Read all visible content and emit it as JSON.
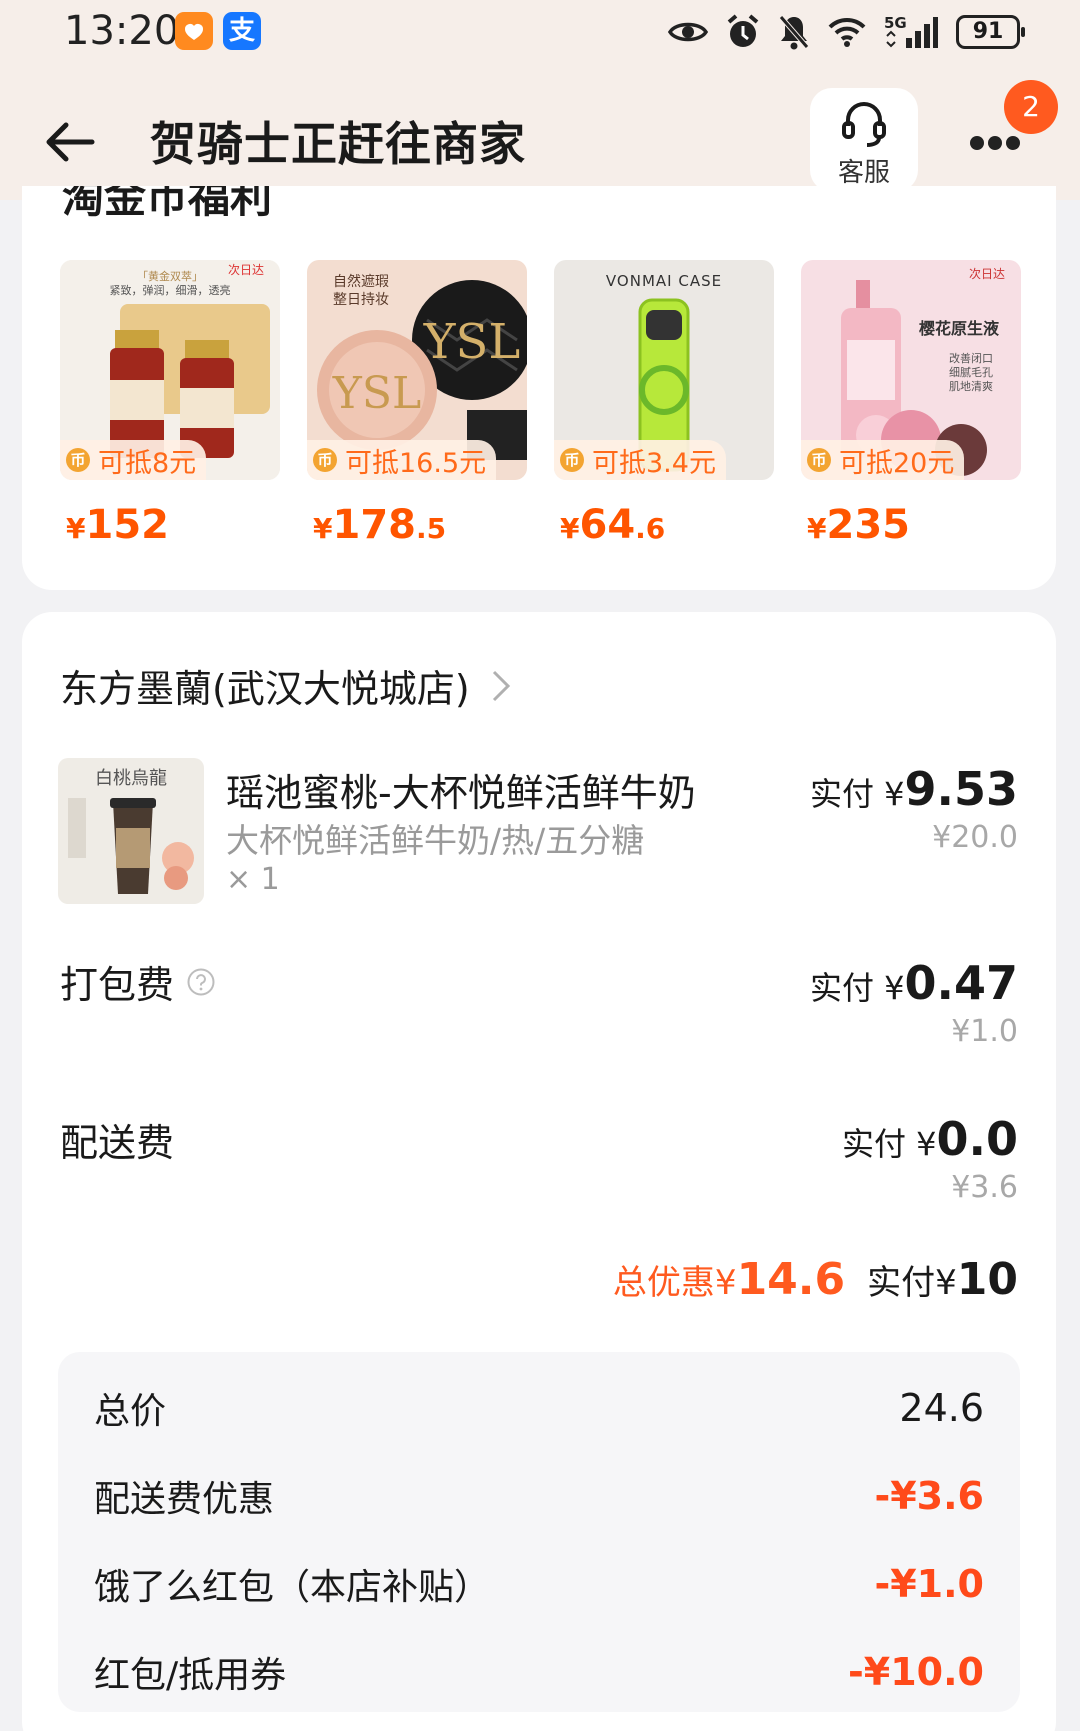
{
  "status_bar": {
    "time": "13:20",
    "apps": [
      "taobao-icon",
      "alipay-icon"
    ],
    "alipay_glyph": "支",
    "network": "5G",
    "battery": "91"
  },
  "header": {
    "title": "贺骑士正赶往商家",
    "customer_service_label": "客服",
    "notification_count": "2"
  },
  "coin_benefits": {
    "title": "淘金币福利",
    "products": [
      {
        "image": "clarins-serum-image",
        "image_texts": [
          "次日达",
          "「黄金双萃」",
          "紧致，弹润，细滑，透亮"
        ],
        "coupon": "可抵8元",
        "price_yen": "¥",
        "price_int": "152",
        "price_dec": ""
      },
      {
        "image": "ysl-cushion-image",
        "image_texts": [
          "自然遮瑕",
          "整日持妆"
        ],
        "coupon": "可抵16.5元",
        "price_yen": "¥",
        "price_int": "178",
        "price_dec": ".5"
      },
      {
        "image": "phone-case-image",
        "image_texts": [
          "VONMAI CASE"
        ],
        "coupon": "可抵3.4元",
        "price_yen": "¥",
        "price_int": "64",
        "price_dec": ".6"
      },
      {
        "image": "estee-lauder-essence-image",
        "image_texts": [
          "次日达",
          "樱花原生液",
          "改善闭口",
          "细腻毛孔",
          "肌地清爽"
        ],
        "coupon": "可抵20元",
        "price_yen": "¥",
        "price_int": "235",
        "price_dec": ""
      }
    ]
  },
  "order": {
    "store_name": "东方墨蘭(武汉大悦城店)",
    "item": {
      "image": "peach-milk-tea-image",
      "image_text": "白桃烏龍",
      "title": "瑶池蜜桃-大杯悦鲜活鲜牛奶",
      "spec": "大杯悦鲜活鲜牛奶/热/五分糖",
      "qty": "× 1",
      "pay_label": "实付 ¥",
      "pay_amount": "9.53",
      "original": "¥20.0"
    },
    "packing_fee": {
      "label": "打包费",
      "pay_label": "实付 ¥",
      "pay_amount": "0.47",
      "original": "¥1.0"
    },
    "delivery_fee": {
      "label": "配送费",
      "pay_label": "实付 ¥",
      "pay_amount": "0.0",
      "original": "¥3.6"
    },
    "summary": {
      "discount_label": "总优惠¥",
      "discount_amount": "14.6",
      "paid_label": "实付¥",
      "paid_amount": "10"
    },
    "breakdown": [
      {
        "label": "总价",
        "value": "24.6",
        "negative": false
      },
      {
        "label": "配送费优惠",
        "value": "-¥3.6",
        "negative": true
      },
      {
        "label": "饿了么红包（本店补贴）",
        "value": "-¥1.0",
        "negative": true
      },
      {
        "label": "红包/抵用券",
        "value": "-¥10.0",
        "negative": true
      }
    ]
  },
  "colors": {
    "accent_orange": "#ff5500",
    "discount_red": "#ff4a1a",
    "header_bg": "#f6eee9",
    "badge": "#ff5a1f"
  }
}
